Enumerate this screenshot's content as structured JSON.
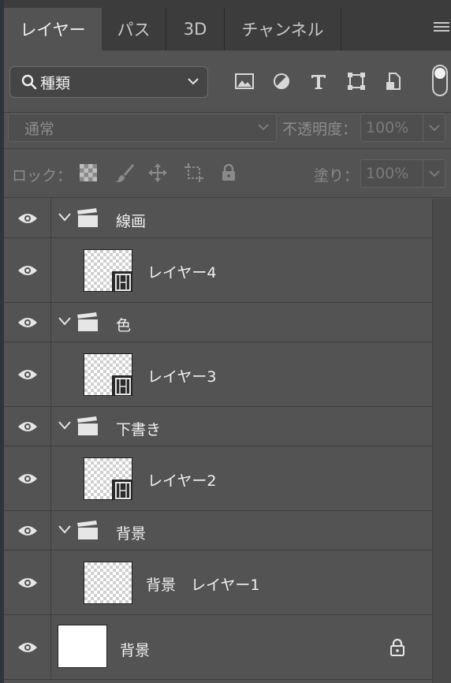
{
  "tabs": [
    {
      "label": "レイヤー",
      "active": true
    },
    {
      "label": "パス",
      "active": false
    },
    {
      "label": "3D",
      "active": false
    },
    {
      "label": "チャンネル",
      "active": false
    }
  ],
  "filter": {
    "kind_label": "種類",
    "icons": [
      "image-filter-icon",
      "adjustment-filter-icon",
      "type-filter-icon",
      "shape-filter-icon",
      "smart-object-filter-icon"
    ]
  },
  "blend": {
    "mode": "通常",
    "opacity_label": "不透明度：",
    "opacity_value": "100%"
  },
  "lock": {
    "label": "ロック：",
    "fill_label": "塗り：",
    "fill_value": "100%"
  },
  "layers": [
    {
      "type": "group",
      "name": "線画"
    },
    {
      "type": "layer",
      "name": "レイヤー4"
    },
    {
      "type": "group",
      "name": "色"
    },
    {
      "type": "layer",
      "name": "レイヤー3"
    },
    {
      "type": "group",
      "name": "下書き"
    },
    {
      "type": "layer",
      "name": "レイヤー2"
    },
    {
      "type": "group",
      "name": "背景"
    },
    {
      "type": "layer",
      "name": "背景　レイヤー1"
    },
    {
      "type": "background",
      "name": "背景"
    }
  ],
  "colors": {
    "panel_bg": "#535353",
    "tab_bar_bg": "#3c3c3c",
    "text": "#f0f0f0",
    "dim_text": "#8c8c8c"
  }
}
